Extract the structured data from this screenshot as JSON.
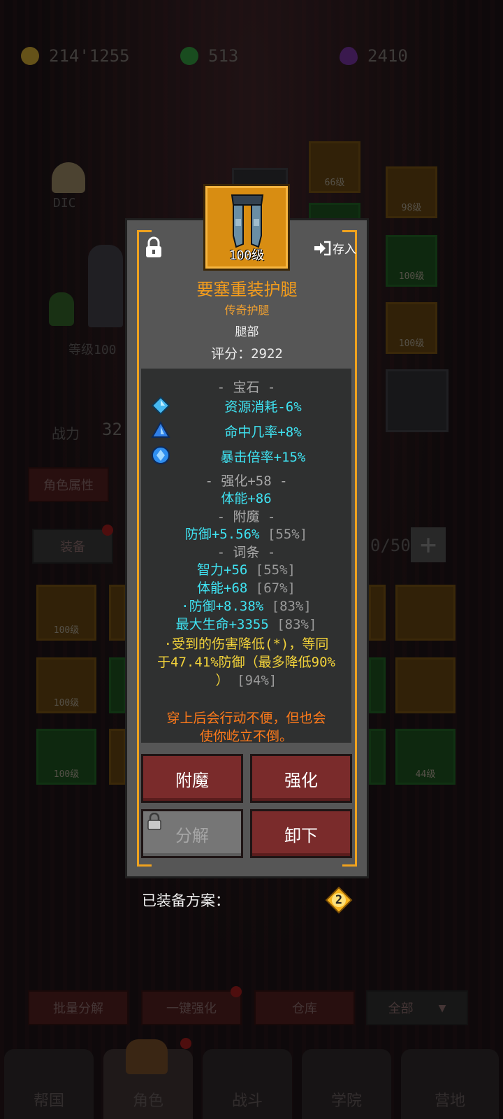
{
  "resources": [
    {
      "name": "gold",
      "value": "214'1255",
      "color": "#b8962e"
    },
    {
      "name": "emerald",
      "value": "513",
      "color": "#2f8a3a"
    },
    {
      "name": "amethyst",
      "value": "2410",
      "color": "#6a2f8f"
    }
  ],
  "item": {
    "level_label": "100级",
    "store_label": "存入",
    "name": "要塞重装护腿",
    "rarity": "传奇护腿",
    "slot": "腿部",
    "score": "评分：2922",
    "gems_header": "- 宝石 -",
    "gems": [
      {
        "text": "资源消耗-6%",
        "icon": "diamond-gem-icon"
      },
      {
        "text": "命中几率+8%",
        "icon": "triangle-gem-icon"
      },
      {
        "text": "暴击倍率+15%",
        "icon": "round-gem-icon"
      }
    ],
    "enhance_header": "- 强化+58 -",
    "enhance_value": "体能+86",
    "enchant_header": "- 附魔 -",
    "enchant_value": "防御+5.56%",
    "enchant_pct": "[55%]",
    "affix_header": "- 词条 -",
    "affixes": [
      {
        "text": "智力+56",
        "pct": "[55%]"
      },
      {
        "text": "体能+68",
        "pct": "[67%]"
      },
      {
        "text": "·防御+8.38%",
        "pct": "[83%]"
      },
      {
        "text": "最大生命+3355",
        "pct": "[83%]"
      }
    ],
    "special_line1": "·受到的伤害降低(*)，等同",
    "special_line2": "于47.41%防御（最多降低90%",
    "special_line3": "）",
    "special_pct": "[94%]",
    "flavor_line1": "穿上后会行动不便，但也会",
    "flavor_line2": "使你屹立不倒。"
  },
  "actions": {
    "enchant": "附魔",
    "enhance": "强化",
    "dismantle": "分解",
    "unequip": "卸下"
  },
  "equipped_plan": {
    "label": "已装备方案：",
    "number": "2"
  },
  "background": {
    "tabs": [
      "帮国",
      "角色",
      "战斗",
      "学院",
      "营地"
    ],
    "buttons": [
      "角色属性",
      "装备",
      "批量分解",
      "一键强化",
      "仓库",
      "全部"
    ],
    "slot_levels": [
      "66级",
      "98级",
      "100级",
      "100级",
      "100级",
      "100级",
      "100级",
      "44级"
    ],
    "capacity": "0/50",
    "power_label": "战力",
    "power_value": "32",
    "level_text": "等级100",
    "name_text": "DIC"
  }
}
